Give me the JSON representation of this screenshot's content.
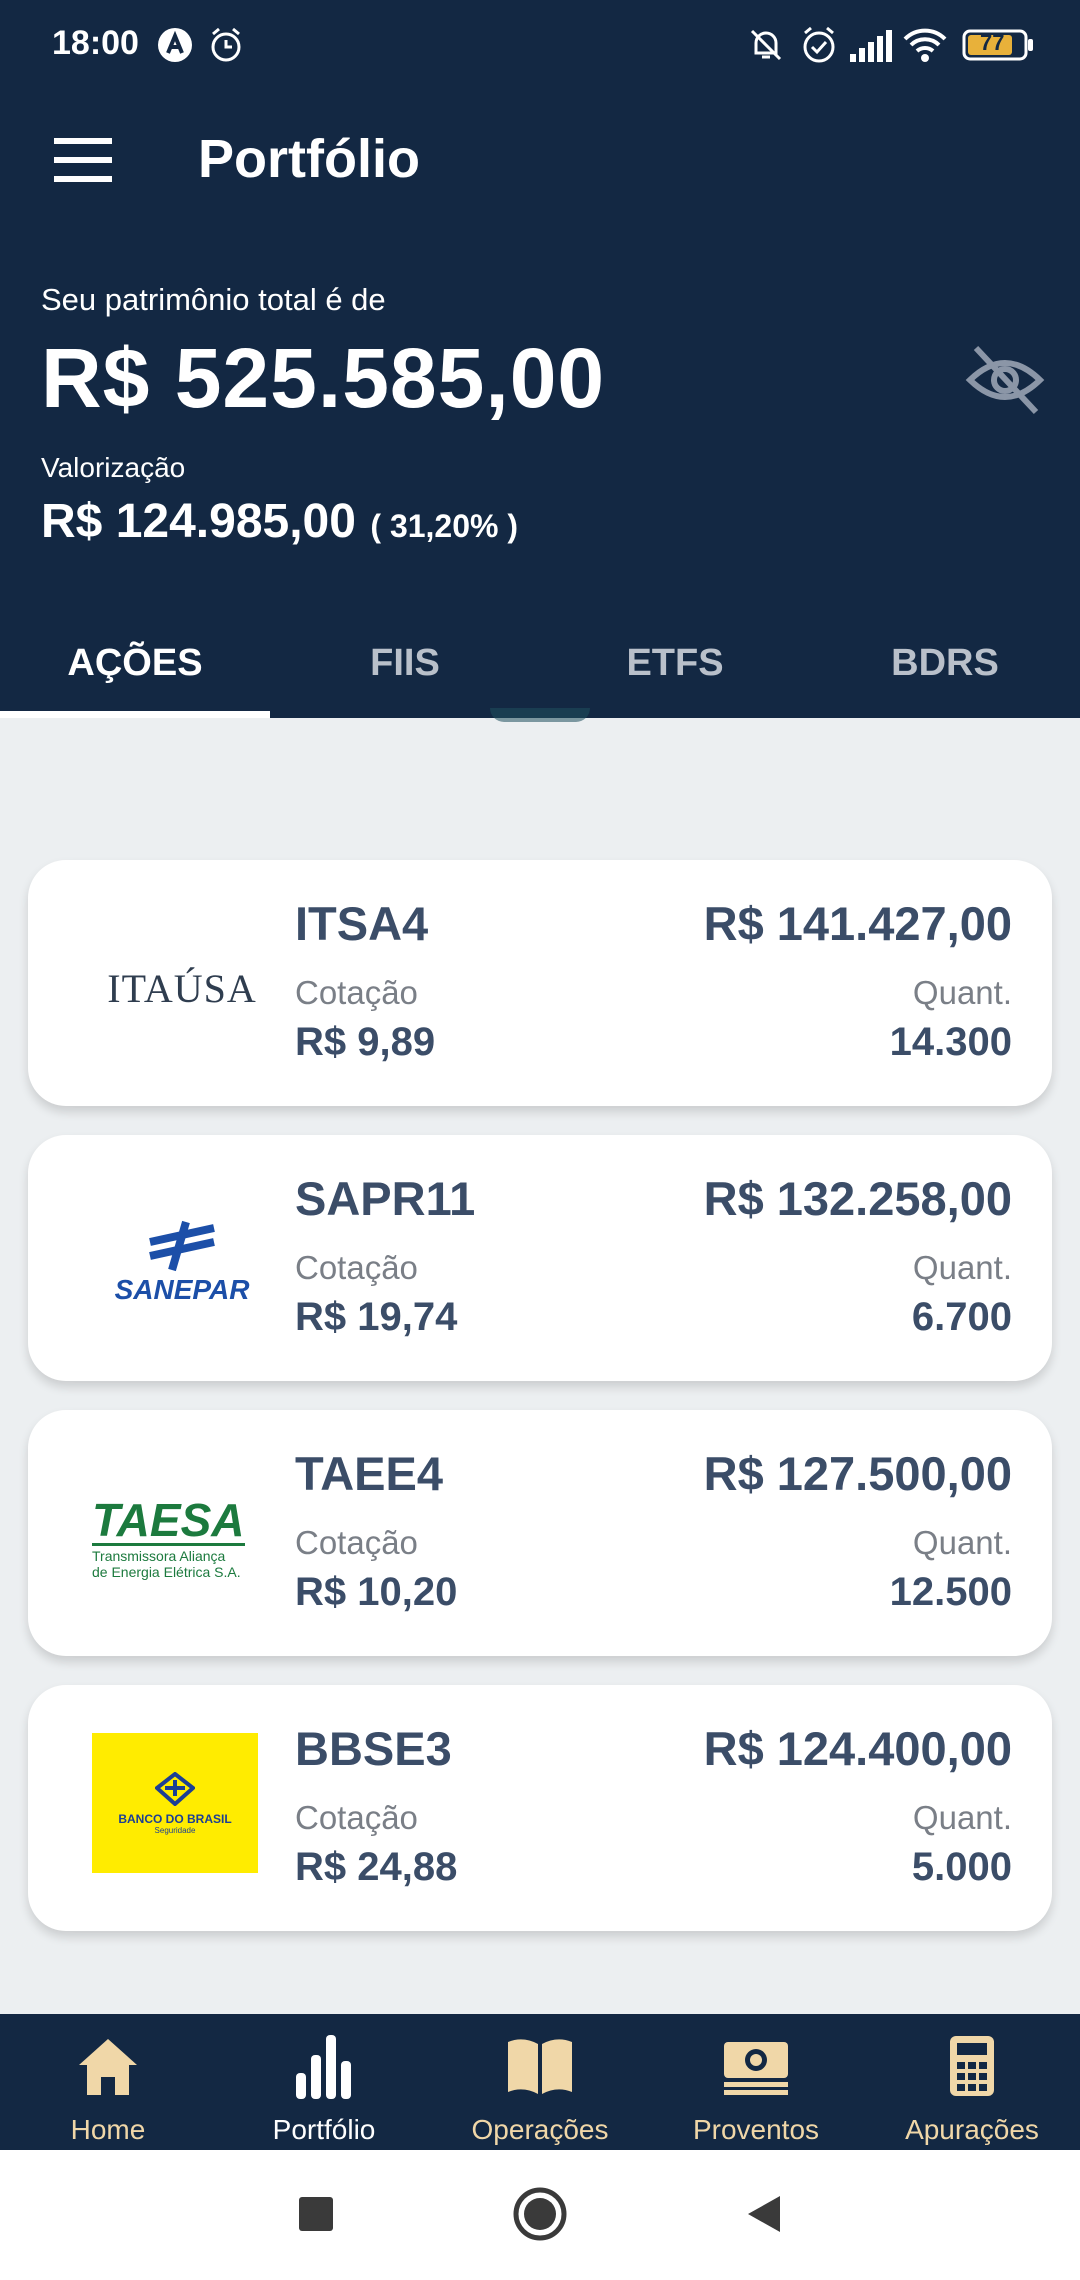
{
  "status_bar": {
    "time": "18:00",
    "battery": "77"
  },
  "app_bar": {
    "title": "Portfólio"
  },
  "summary": {
    "label": "Seu patrimônio total é de",
    "total": "R$ 525.585,00",
    "valorizacao_label": "Valorização",
    "valorizacao_amount": "R$ 124.985,00",
    "valorizacao_percent": "( 31,20% )"
  },
  "tabs": [
    {
      "label": "AÇÕES",
      "active": true
    },
    {
      "label": "FIIS",
      "active": false
    },
    {
      "label": "ETFS",
      "active": false
    },
    {
      "label": "BDRS",
      "active": false
    }
  ],
  "assets": [
    {
      "ticker": "ITSA4",
      "logo": "ITAÚSA",
      "cot_label": "Cotação",
      "cot_value": "R$ 9,89",
      "total": "R$ 141.427,00",
      "qty_label": "Quant.",
      "qty_value": "14.300"
    },
    {
      "ticker": "SAPR11",
      "logo": "SANEPAR",
      "cot_label": "Cotação",
      "cot_value": "R$ 19,74",
      "total": "R$ 132.258,00",
      "qty_label": "Quant.",
      "qty_value": "6.700"
    },
    {
      "ticker": "TAEE4",
      "logo": "TAESA",
      "logo_sub1": "Transmissora Aliança",
      "logo_sub2": "de Energia Elétrica S.A.",
      "cot_label": "Cotação",
      "cot_value": "R$ 10,20",
      "total": "R$ 127.500,00",
      "qty_label": "Quant.",
      "qty_value": "12.500"
    },
    {
      "ticker": "BBSE3",
      "logo": "BANCO DO BRASIL",
      "logo_sub1": "Seguridade",
      "cot_label": "Cotação",
      "cot_value": "R$ 24,88",
      "total": "R$ 124.400,00",
      "qty_label": "Quant.",
      "qty_value": "5.000"
    }
  ],
  "bottom_nav": [
    {
      "label": "Home",
      "icon": "home-icon"
    },
    {
      "label": "Portfólio",
      "icon": "bar-chart-icon",
      "active": true
    },
    {
      "label": "Operações",
      "icon": "book-icon"
    },
    {
      "label": "Proventos",
      "icon": "money-icon"
    },
    {
      "label": "Apurações",
      "icon": "calculator-icon"
    }
  ],
  "colors": {
    "header_bg": "#132843",
    "card_text": "#3b4d68",
    "nav_label": "#f0d7a8",
    "page_bg": "#eceff1"
  }
}
